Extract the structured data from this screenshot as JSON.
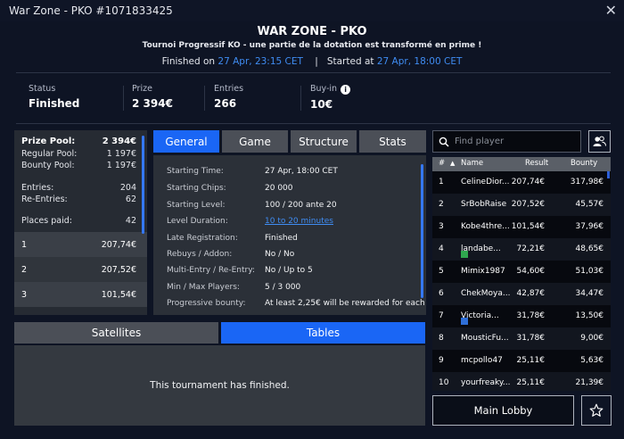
{
  "window": {
    "title": "War Zone - PKO #1071833425",
    "close_glyph": "✕"
  },
  "header": {
    "title": "WAR ZONE - PKO",
    "subtitle": "Tournoi Progressif KO - une partie de la dotation est transformé en prime !",
    "finished_label": "Finished on",
    "finished_value": "27 Apr, 23:15 CET",
    "separator": "|",
    "started_label": "Started at",
    "started_value": "27 Apr, 18:00 CET"
  },
  "stats": {
    "status_label": "Status",
    "status_value": "Finished",
    "prize_label": "Prize",
    "prize_value": "2 394€",
    "entries_label": "Entries",
    "entries_value": "266",
    "buyin_label": "Buy-in",
    "buyin_value": "10€",
    "buyin_icon": "info-icon"
  },
  "prize_panel": {
    "pool_label": "Prize Pool:",
    "pool_value": "2 394€",
    "regular_label": "Regular Pool:",
    "regular_value": "1 197€",
    "bounty_label": "Bounty Pool:",
    "bounty_value": "1 197€",
    "entries_label": "Entries:",
    "entries_value": "204",
    "reentries_label": "Re-Entries:",
    "reentries_value": "62",
    "places_label": "Places paid:",
    "places_value": "42",
    "places": [
      {
        "rank": "1",
        "amount": "207,74€"
      },
      {
        "rank": "2",
        "amount": "207,52€"
      },
      {
        "rank": "3",
        "amount": "101,54€"
      }
    ]
  },
  "tabs": [
    "General",
    "Game",
    "Structure",
    "Stats"
  ],
  "general": {
    "rows": [
      {
        "label": "Starting Time:",
        "value": "27 Apr, 18:00 CET"
      },
      {
        "label": "Starting Chips:",
        "value": "20 000"
      },
      {
        "label": "Starting Level:",
        "value": "100 / 200 ante 20"
      },
      {
        "label": "Level Duration:",
        "value": "10 to 20 minutes"
      },
      {
        "label": "Late Registration:",
        "value": "Finished"
      },
      {
        "label": "Rebuys / Addon:",
        "value": "No / No"
      },
      {
        "label": "Multi-Entry / Re-Entry:",
        "value": "No / Up to 5"
      },
      {
        "label": "Min / Max Players:",
        "value": "5 / 3 000"
      },
      {
        "label": "Progressive bounty:",
        "value": "At least 2,25€ will be rewarded for each"
      }
    ]
  },
  "bottom_tabs": {
    "satellites": "Satellites",
    "tables": "Tables"
  },
  "tables_message": "This tournament has finished.",
  "players": {
    "search_placeholder": "Find player",
    "headers": {
      "rank": "#",
      "sort_arrow": "▲",
      "name": "Name",
      "result": "Result",
      "bounty": "Bounty"
    },
    "rows": [
      {
        "rank": "1",
        "name": "CelineDior...",
        "result": "207,74€",
        "bounty": "317,98€",
        "flag": ""
      },
      {
        "rank": "2",
        "name": "SrBobRaise",
        "result": "207,52€",
        "bounty": "45,57€",
        "flag": ""
      },
      {
        "rank": "3",
        "name": "Kobe4thre...",
        "result": "101,54€",
        "bounty": "37,96€",
        "flag": ""
      },
      {
        "rank": "4",
        "name": "landabe...",
        "result": "72,21€",
        "bounty": "48,65€",
        "flag": "#2fa84f"
      },
      {
        "rank": "5",
        "name": "Mimix1987",
        "result": "54,60€",
        "bounty": "51,03€",
        "flag": ""
      },
      {
        "rank": "6",
        "name": "ChekMoya...",
        "result": "42,87€",
        "bounty": "34,47€",
        "flag": ""
      },
      {
        "rank": "7",
        "name": "Victoria...",
        "result": "31,78€",
        "bounty": "13,50€",
        "flag": "#2f6fd8"
      },
      {
        "rank": "8",
        "name": "MousticFu...",
        "result": "31,78€",
        "bounty": "9,00€",
        "flag": ""
      },
      {
        "rank": "9",
        "name": "mcpollo47",
        "result": "25,11€",
        "bounty": "5,63€",
        "flag": ""
      },
      {
        "rank": "10",
        "name": "yourfreaky...",
        "result": "25,11€",
        "bounty": "21,39€",
        "flag": ""
      }
    ]
  },
  "buttons": {
    "main_lobby": "Main Lobby"
  },
  "colors": {
    "accent": "#1a66f5",
    "link": "#3f8cf2",
    "background": "#0e1424"
  }
}
